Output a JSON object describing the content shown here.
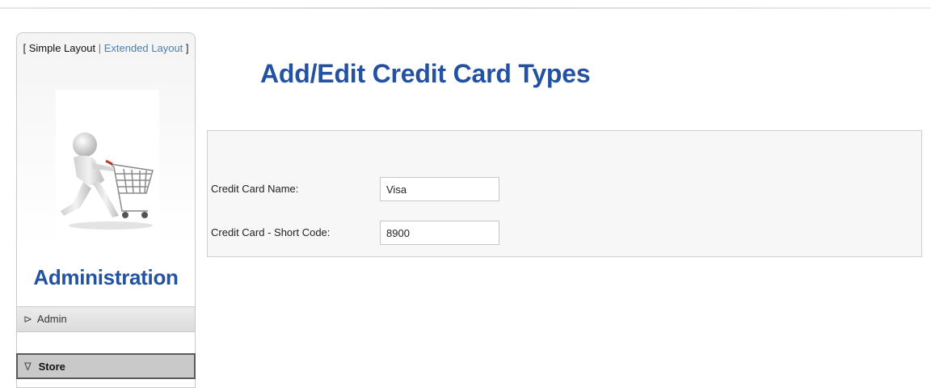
{
  "sidebar": {
    "layout_switch": {
      "open_bracket": "[",
      "simple": "Simple Layout",
      "separator": "|",
      "extended": "Extended Layout",
      "close_bracket": "]"
    },
    "title": "Administration",
    "items": [
      {
        "label": "Admin",
        "icon": "chevron-right-icon"
      },
      {
        "label": "Store",
        "icon": "chevron-down-icon"
      }
    ]
  },
  "main": {
    "title": "Add/Edit Credit Card Types",
    "form": {
      "name_label": "Credit Card Name:",
      "name_value": "Visa",
      "code_label": "Credit Card - Short Code:",
      "code_value": "8900"
    }
  },
  "colors": {
    "title_blue": "#2352a3",
    "link_blue": "#4a7fb5",
    "panel_bg": "#f7f7f7"
  }
}
